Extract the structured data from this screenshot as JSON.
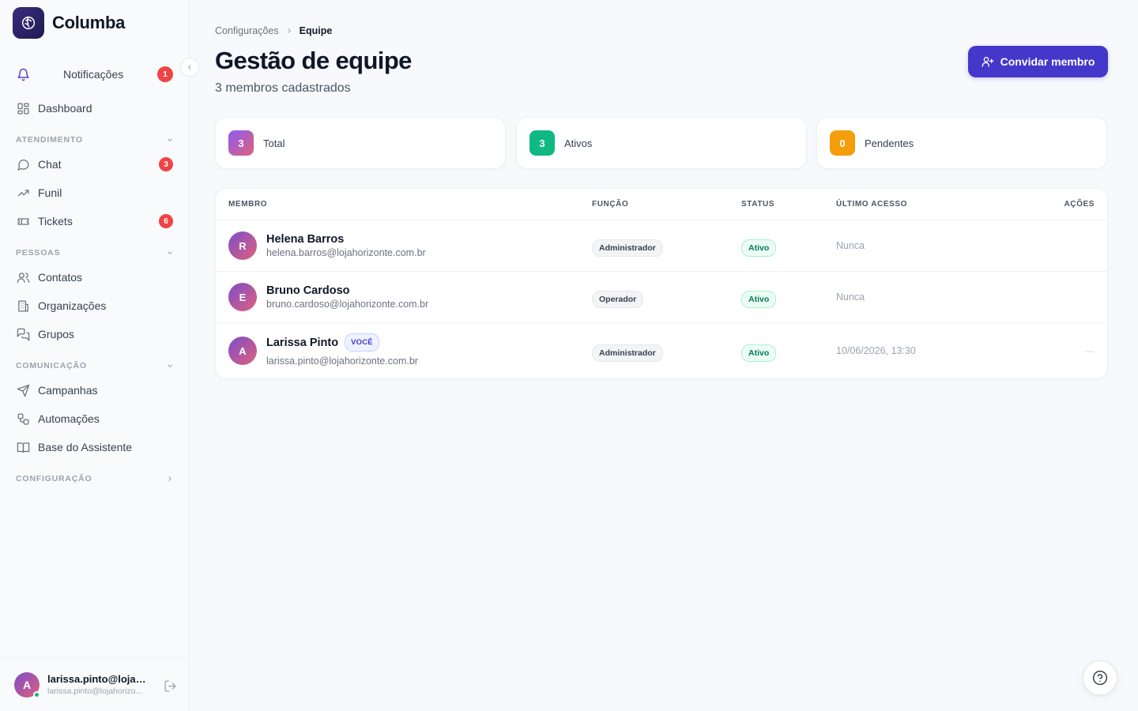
{
  "brand": {
    "name": "Columba"
  },
  "nav": {
    "notifications": {
      "label": "Notificações",
      "badge": "1"
    },
    "dashboard": {
      "label": "Dashboard"
    },
    "sections": [
      {
        "title": "ATENDIMENTO",
        "items": [
          {
            "label": "Chat",
            "badge": "3"
          },
          {
            "label": "Funil"
          },
          {
            "label": "Tickets",
            "badge": "6"
          }
        ]
      },
      {
        "title": "PESSOAS",
        "items": [
          {
            "label": "Contatos"
          },
          {
            "label": "Organizações"
          },
          {
            "label": "Grupos"
          }
        ]
      },
      {
        "title": "COMUNICAÇÃO",
        "items": [
          {
            "label": "Campanhas"
          },
          {
            "label": "Automações"
          },
          {
            "label": "Base do Assistente"
          }
        ]
      },
      {
        "title": "CONFIGURAÇÃO",
        "items": []
      }
    ]
  },
  "user": {
    "initial": "A",
    "name": "larissa.pinto@lojah...",
    "email": "larissa.pinto@lojahorizo..."
  },
  "breadcrumb": {
    "parent": "Configurações",
    "current": "Equipe"
  },
  "page": {
    "title": "Gestão de equipe",
    "subtitle": "3 membros cadastrados",
    "invite_label": "Convidar membro"
  },
  "stats": [
    {
      "value": "3",
      "label": "Total",
      "color": "#8b5cf6"
    },
    {
      "value": "3",
      "label": "Ativos",
      "color": "#10b981"
    },
    {
      "value": "0",
      "label": "Pendentes",
      "color": "#f59e0b"
    }
  ],
  "table": {
    "headers": {
      "member": "MEMBRO",
      "role": "FUNÇÃO",
      "status": "STATUS",
      "last_access": "ÚLTIMO ACESSO",
      "actions": "AÇÕES"
    },
    "rows": [
      {
        "initial": "R",
        "name": "Helena Barros",
        "email": "helena.barros@lojahorizonte.com.br",
        "role": "Administrador",
        "status": "Ativo",
        "last_access": "Nunca"
      },
      {
        "initial": "E",
        "name": "Bruno Cardoso",
        "email": "bruno.cardoso@lojahorizonte.com.br",
        "role": "Operador",
        "status": "Ativo",
        "last_access": "Nunca"
      },
      {
        "initial": "A",
        "name": "Larissa Pinto",
        "you_badge": "VOCÊ",
        "email": "larissa.pinto@lojahorizonte.com.br",
        "role": "Administrador",
        "status": "Ativo",
        "last_access": "10/06/2026, 13:30",
        "action": "—"
      }
    ]
  },
  "colors": {
    "accent": "#4338ca",
    "danger": "#ef4444",
    "success": "#10b981"
  }
}
